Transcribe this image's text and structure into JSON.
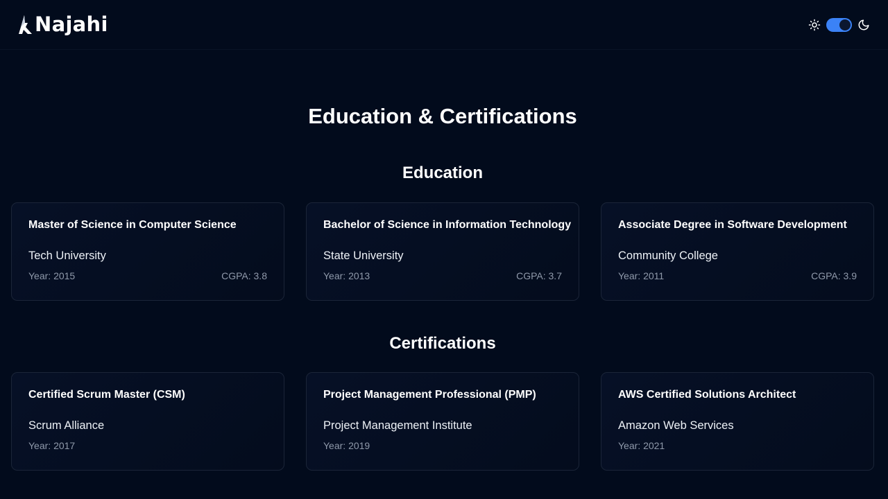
{
  "header": {
    "brand": "Najahi",
    "icons": {
      "light": "sun-icon",
      "dark": "moon-icon"
    },
    "theme_toggle": {
      "state": "dark",
      "accent": "#3b82f6"
    }
  },
  "page": {
    "title": "Education & Certifications"
  },
  "education": {
    "heading": "Education",
    "items": [
      {
        "degree": "Master of Science in Computer Science",
        "institution": "Tech University",
        "year": "Year: 2015",
        "cgpa": "CGPA: 3.8"
      },
      {
        "degree": "Bachelor of Science in Information Technology",
        "institution": "State University",
        "year": "Year: 2013",
        "cgpa": "CGPA: 3.7"
      },
      {
        "degree": "Associate Degree in Software Development",
        "institution": "Community College",
        "year": "Year: 2011",
        "cgpa": "CGPA: 3.9"
      }
    ]
  },
  "certifications": {
    "heading": "Certifications",
    "items": [
      {
        "name": "Certified Scrum Master (CSM)",
        "issuer": "Scrum Alliance",
        "year": "Year: 2017"
      },
      {
        "name": "Project Management Professional (PMP)",
        "issuer": "Project Management Institute",
        "year": "Year: 2019"
      },
      {
        "name": "AWS Certified Solutions Architect",
        "issuer": "Amazon Web Services",
        "year": "Year: 2021"
      }
    ]
  },
  "colors": {
    "background": "#020b1c",
    "card_border": "#1b2538",
    "muted_text": "#8f99aa",
    "accent": "#3b82f6"
  }
}
